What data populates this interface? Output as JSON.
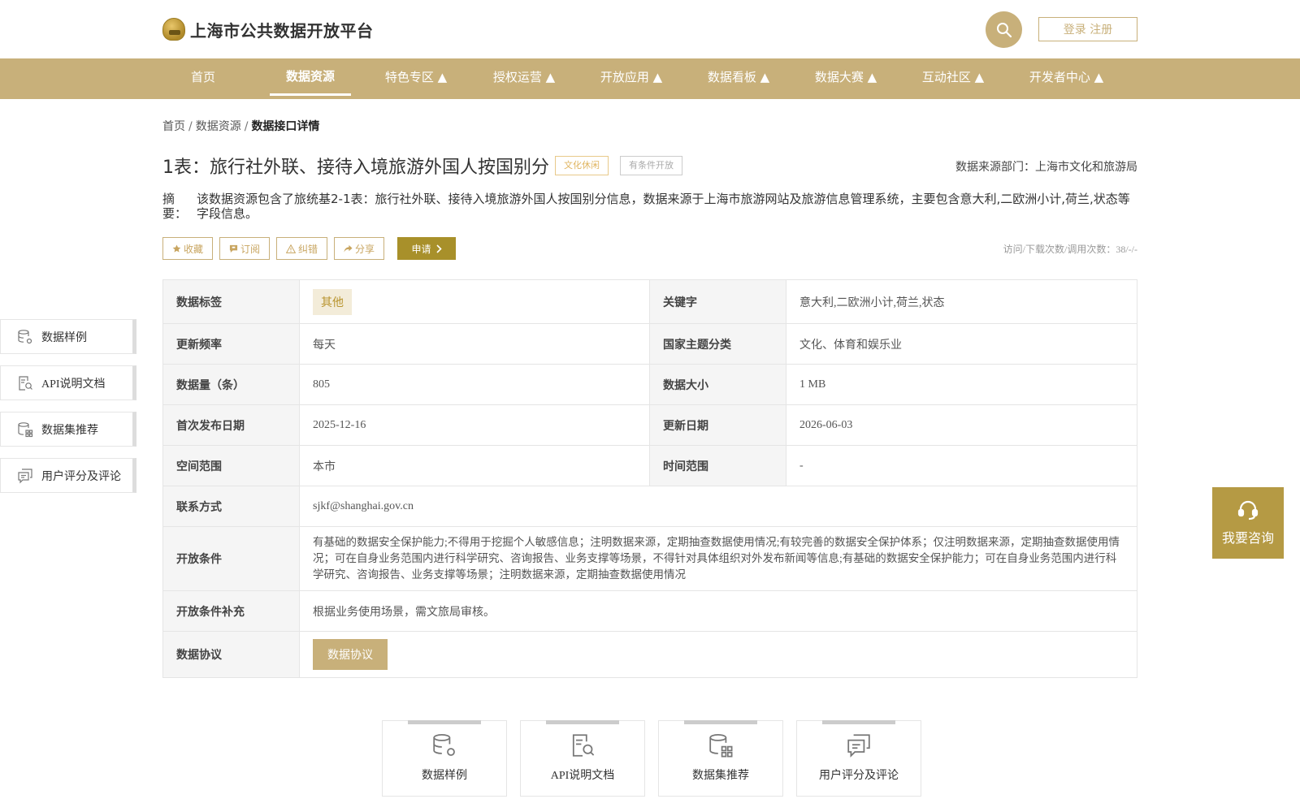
{
  "header": {
    "site_title": "上海市公共数据开放平台",
    "login_label": "登录 注册"
  },
  "nav": {
    "items": [
      {
        "label": "首页"
      },
      {
        "label": "数据资源",
        "active": true
      },
      {
        "label": "特色专区 ▲"
      },
      {
        "label": "授权运营 ▲"
      },
      {
        "label": "开放应用 ▲"
      },
      {
        "label": "数据看板 ▲"
      },
      {
        "label": "数据大赛 ▲"
      },
      {
        "label": "互动社区 ▲"
      },
      {
        "label": "开发者中心 ▲"
      }
    ]
  },
  "breadcrumb": {
    "items": [
      "首页",
      "数据资源"
    ],
    "separator": "/",
    "current": "数据接口详情"
  },
  "dataset": {
    "title": "1表：旅行社外联、接待入境旅游外国人按国别分",
    "tags": [
      "文化休闲",
      "有条件开放"
    ],
    "source": "数据来源部门：上海市文化和旅游局",
    "abstract_label": "摘　要：",
    "abstract": "该数据资源包含了旅统基2-1表：旅行社外联、接待入境旅游外国人按国别分信息，数据来源于上海市旅游网站及旅游信息管理系统，主要包含意大利,二欧洲小计,荷兰,状态等字段信息。",
    "visits": "访问/下载次数/调用次数：38/-/-"
  },
  "actions": {
    "collect": "收藏",
    "subscribe": "订阅",
    "correct": "纠错",
    "share": "分享",
    "apply": "申请"
  },
  "info": {
    "data_tag_label": "数据标签",
    "data_tag_value": "其他",
    "keywords_label": "关键字",
    "keywords_value": "意大利,二欧洲小计,荷兰,状态",
    "frequency_label": "更新频率",
    "frequency_value": "每天",
    "theme_label": "国家主题分类",
    "theme_value": "文化、体育和娱乐业",
    "count_label": "数据量（条）",
    "count_value": "805",
    "size_label": "数据大小",
    "size_value": "1 MB",
    "first_pub_label": "首次发布日期",
    "first_pub_value": "2025-12-16",
    "update_label": "更新日期",
    "update_value": "2026-06-03",
    "space_label": "空间范围",
    "space_value": "本市",
    "time_label": "时间范围",
    "time_value": "-",
    "contact_label": "联系方式",
    "contact_value": "sjkf@shanghai.gov.cn",
    "cond_label": "开放条件",
    "cond_value": "有基础的数据安全保护能力;不得用于挖掘个人敏感信息；注明数据来源，定期抽查数据使用情况;有较完善的数据安全保护体系；仅注明数据来源，定期抽查数据使用情况；可在自身业务范围内进行科学研究、咨询报告、业务支撑等场景，不得针对具体组织对外发布新闻等信息;有基础的数据安全保护能力；可在自身业务范围内进行科学研究、咨询报告、业务支撑等场景；注明数据来源，定期抽查数据使用情况",
    "cond_extra_label": "开放条件补充",
    "cond_extra_value": "根据业务使用场景，需文旅局审核。",
    "protocol_label": "数据协议",
    "protocol_button": "数据协议"
  },
  "sidenav": {
    "items": [
      "数据样例",
      "API说明文档",
      "数据集推荐",
      "用户评分及评论"
    ]
  },
  "consult": {
    "label": "我要咨询"
  },
  "cards": {
    "items": [
      "数据样例",
      "API说明文档",
      "数据集推荐",
      "用户评分及评论"
    ]
  },
  "colors": {
    "brand": "#c8b07a",
    "apply": "#a8902a",
    "consult": "#b59a44"
  }
}
